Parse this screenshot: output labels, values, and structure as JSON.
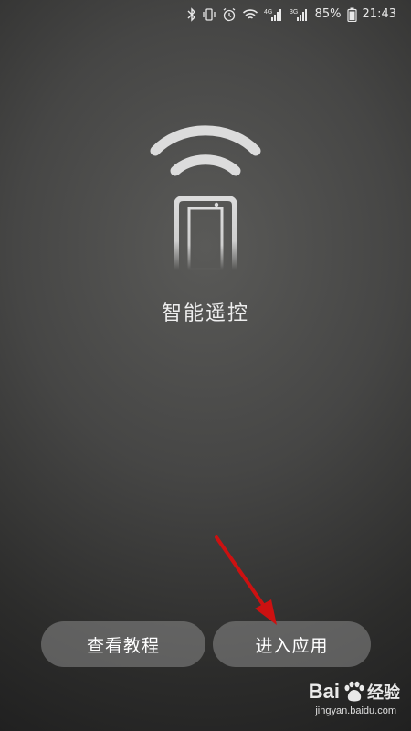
{
  "status_bar": {
    "icons": [
      "bluetooth-icon",
      "vibrate-icon",
      "alarm-icon",
      "wifi-icon",
      "signal-4g-icon",
      "signal-3g-icon"
    ],
    "network_4g": "4G",
    "network_3g": "3G",
    "battery": "85%",
    "time": "21:43"
  },
  "app": {
    "logo_icon": "remote-phone-wifi-icon",
    "title": "智能遥控"
  },
  "buttons": {
    "tutorial": "查看教程",
    "enter": "进入应用"
  },
  "watermark": {
    "brand": "Bai",
    "brand_suffix": "经验",
    "site": "jingyan.baidu.com"
  },
  "colors": {
    "annotation_arrow": "#cc1111",
    "text": "#eeeeee",
    "button_bg": "#8c8c8c"
  }
}
